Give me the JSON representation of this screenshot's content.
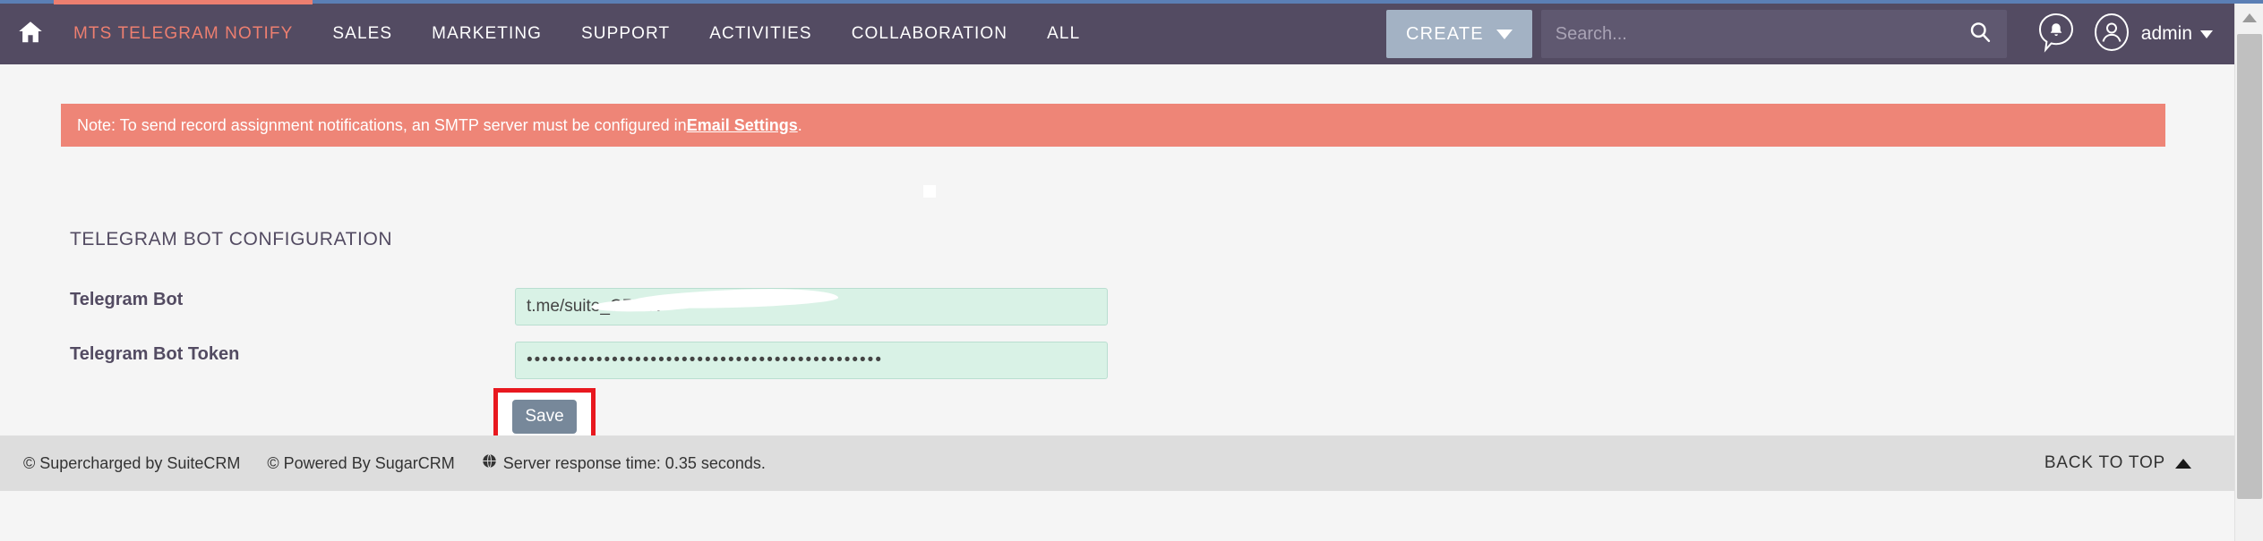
{
  "navbar": {
    "home_icon": "home-icon",
    "items": [
      {
        "label": "MTS TELEGRAM NOTIFY",
        "active": true
      },
      {
        "label": "SALES",
        "active": false
      },
      {
        "label": "MARKETING",
        "active": false
      },
      {
        "label": "SUPPORT",
        "active": false
      },
      {
        "label": "ACTIVITIES",
        "active": false
      },
      {
        "label": "COLLABORATION",
        "active": false
      },
      {
        "label": "ALL",
        "active": false
      }
    ],
    "create_label": "CREATE",
    "search_placeholder": "Search...",
    "search_value": "",
    "notifications_icon": "notification-bell-icon",
    "avatar_icon": "user-avatar-icon",
    "user_label": "admin",
    "colors": {
      "navbar_bg": "#534b62",
      "active_accent": "#ed7f70",
      "create_bg": "#a3b2c4",
      "search_bg": "#5f5870"
    }
  },
  "sidebar": {
    "toggle_icon": "expand-sidebar-arrow-icon"
  },
  "alert": {
    "text_before": "Note: To send record assignment notifications, an SMTP server must be configured in ",
    "link_label": "Email Settings",
    "text_after": ".",
    "bg_color": "#ee8577"
  },
  "main": {
    "section_title": "TELEGRAM BOT CONFIGURATION",
    "fields": [
      {
        "label": "Telegram Bot",
        "value": "t.me/suite_CRMN",
        "placeholder": "",
        "type": "text"
      },
      {
        "label": "Telegram Bot Token",
        "value": "••••••••••••••••••••••••••••••••••••••••••••••",
        "placeholder": "",
        "type": "password"
      }
    ],
    "save_label": "Save",
    "annotation_color": "#e8181f",
    "input_bg": "#d9f2e6"
  },
  "footer": {
    "supercharged": "© Supercharged by SuiteCRM",
    "powered": "© Powered By SugarCRM",
    "globe_icon": "globe-icon",
    "response_time": "Server response time: 0.35 seconds.",
    "back_to_top": "BACK TO TOP"
  }
}
